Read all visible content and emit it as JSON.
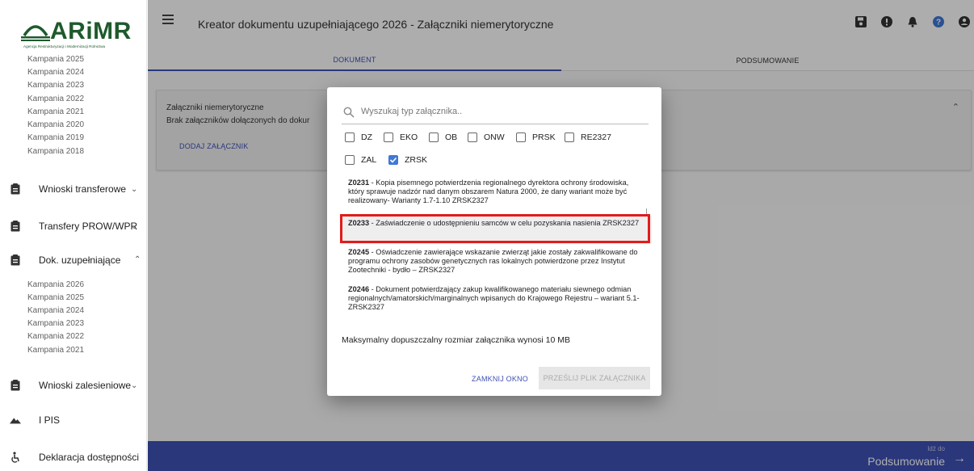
{
  "logo": {
    "text": "ARiMR",
    "subtext": "Agencja Restrukturyzacji i Modernizacji Rolnictwa"
  },
  "sidebar": {
    "campaigns_top": [
      "Kampania 2025",
      "Kampania 2024",
      "Kampania 2023",
      "Kampania 2022",
      "Kampania 2021",
      "Kampania 2020",
      "Kampania 2019",
      "Kampania 2018"
    ],
    "items": [
      {
        "label": "Wnioski transferowe",
        "icon": "clipboard-icon",
        "chevron": "chevron-down-icon"
      },
      {
        "label": "Transfery PROW/WPR",
        "icon": "clipboard-icon",
        "chevron": "chevron-down-icon"
      },
      {
        "label": "Dok. uzupełniające",
        "icon": "clipboard-icon",
        "chevron": "chevron-up-icon"
      },
      {
        "label": "Wnioski zalesieniowe",
        "icon": "clipboard-icon",
        "chevron": "chevron-down-icon"
      },
      {
        "label": "I PIS",
        "icon": "mountain-icon"
      },
      {
        "label": "Deklaracja dostępności",
        "icon": "accessibility-icon"
      }
    ],
    "campaigns_sub": [
      "Kampania 2026",
      "Kampania 2025",
      "Kampania 2024",
      "Kampania 2023",
      "Kampania 2022",
      "Kampania 2021"
    ]
  },
  "header": {
    "title": "Kreator dokumentu uzupełniającego 2026 - Załączniki niemerytoryczne"
  },
  "tabs": [
    {
      "label": "DOKUMENT"
    },
    {
      "label": "PODSUMOWANIE"
    }
  ],
  "card": {
    "title": "Załączniki niemerytoryczne",
    "subtitle": "Brak załączników dołączonych do dokur",
    "add_link": "DODAJ ZAŁĄCZNIK"
  },
  "bottom": {
    "small": "Idź do",
    "big": "Podsumowanie"
  },
  "modal": {
    "search_placeholder": "Wyszukaj typ załącznika..",
    "filters": [
      {
        "label": "DZ",
        "checked": false
      },
      {
        "label": "EKO",
        "checked": false
      },
      {
        "label": "OB",
        "checked": false
      },
      {
        "label": "ONW",
        "checked": false
      },
      {
        "label": "PRSK",
        "checked": false
      },
      {
        "label": "RE2327",
        "checked": false
      },
      {
        "label": "ZAL",
        "checked": false
      },
      {
        "label": "ZRSK",
        "checked": true
      }
    ],
    "options": [
      {
        "code": "Z0231",
        "text": " - Kopia pisemnego potwierdzenia regionalnego dyrektora ochrony środowiska, który sprawuje nadzór nad danym obszarem Natura 2000, że dany wariant może być realizowany- Warianty 1.7-1.10 ZRSK2327"
      },
      {
        "code": "Z0233",
        "text": " - Zaświadczenie o udostępnieniu samców w celu pozyskania nasienia ZRSK2327"
      },
      {
        "code": "Z0245",
        "text": " - Oświadczenie zawierające wskazanie zwierząt jakie zostały zakwalifikowane do programu ochrony zasobów genetycznych ras lokalnych potwierdzone przez Instytut Zootechniki - bydło – ZRSK2327"
      },
      {
        "code": "Z0246",
        "text": " - Dokument potwierdzający zakup kwalifikowanego materiału siewnego odmian regionalnych/amatorskich/marginalnych wpisanych do Krajowego Rejestru – wariant 5.1-ZRSK2327"
      }
    ],
    "max_size": "Maksymalny dopuszczalny rozmiar załącznika wynosi 10 MB",
    "close_label": "ZAMKNIJ OKNO",
    "send_label": "PRZEŚLIJ PLIK ZAŁĄCZNIKA"
  },
  "colors": {
    "accent": "#3f51b5",
    "highlight_frame": "#e31b1b",
    "checkbox_checked": "#3f78d6",
    "logo_green": "#1e5a2c"
  }
}
